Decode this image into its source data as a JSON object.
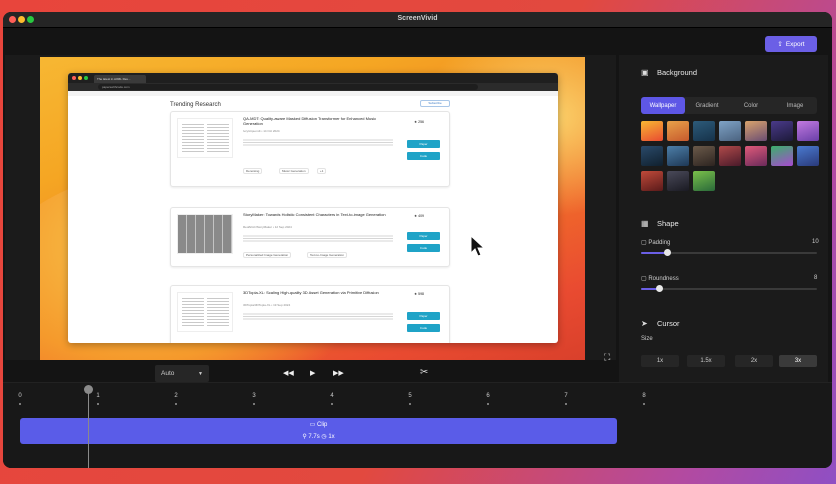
{
  "window": {
    "title": "ScreenVivid"
  },
  "toolbar": {
    "export_label": "Export"
  },
  "preview": {
    "browser": {
      "tab_title": "The latest in AI/ML Res...",
      "url": "paperswithcode.com",
      "page_heading": "Trending Research",
      "subscribe_label": "Subscribe",
      "papers": [
        {
          "title": "QA-MDT: Quality-aware Masked Diffusion Transformer for Enhanced Music Generation",
          "meta": "ivcylc/qa-mdt • 14 Oct 2024",
          "tags": [
            "Denoising",
            "Music Generation",
            "+1"
          ],
          "stars": "256",
          "paper_label": "Paper",
          "code_label": "Code"
        },
        {
          "title": "StoryMaker: Towards Holistic Consistent Characters in Text-to-image Generation",
          "meta": "RedAIGC/StoryMaker • 12 Sep 2024",
          "tags": [
            "Personalized Image Generation",
            "Text-to-Image Generation"
          ],
          "stars": "409",
          "paper_label": "Paper",
          "code_label": "Code"
        },
        {
          "title": "3DTopia-XL: Scaling High-quality 3D Asset Generation via Primitive Diffusion",
          "meta": "3DTopia/3DTopia-XL • 19 Sep 2024",
          "tags": [],
          "stars": "598",
          "paper_label": "Paper",
          "code_label": "Code"
        }
      ]
    }
  },
  "panel": {
    "background": {
      "title": "Background",
      "tabs": [
        "Wallpaper",
        "Gradient",
        "Color",
        "Image"
      ],
      "active_tab": "Wallpaper"
    },
    "shape": {
      "title": "Shape",
      "padding_label": "Padding",
      "padding_value": "10",
      "roundness_label": "Roundness",
      "roundness_value": "8"
    },
    "cursor": {
      "title": "Cursor",
      "size_label": "Size",
      "sizes": [
        "1x",
        "1.5x",
        "2x",
        "3x"
      ],
      "active_size": "3x"
    }
  },
  "playback": {
    "speed_select": "Auto"
  },
  "timeline": {
    "ticks": [
      "0",
      "1",
      "2",
      "3",
      "4",
      "5",
      "6",
      "7",
      "8"
    ],
    "clip_label": "Clip",
    "clip_info": "7.7s",
    "clip_speed": "1x"
  },
  "colors": {
    "accent": "#5e57e6",
    "clip": "#5a5ce8",
    "window_bg": "#141414"
  }
}
